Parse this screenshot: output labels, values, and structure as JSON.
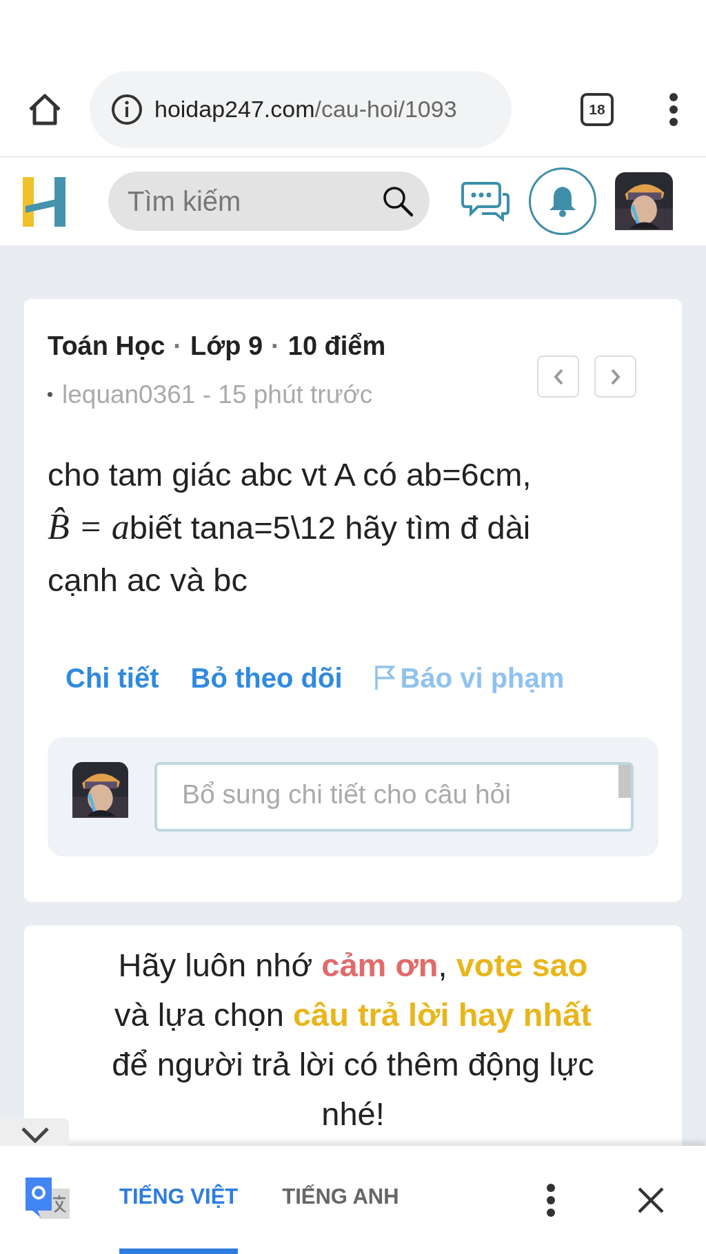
{
  "browser": {
    "url_domain": "hoidap247.com",
    "url_path": "/cau-hoi/1093",
    "tab_count": "18"
  },
  "header": {
    "search": {
      "placeholder": "Tìm kiếm"
    }
  },
  "question": {
    "subject": "Toán Học",
    "separator_1": "·",
    "grade": "Lớp 9",
    "separator_2": "·",
    "points": "10 điểm",
    "author_line": "lequan0361 - 15 phút trước",
    "body": [
      {
        "text": "cho tam giác abc vt A có ab=6cm, ",
        "kind": "text"
      },
      {
        "text": "B̂ = a",
        "kind": "math"
      },
      {
        "text": "biết tana=5\\12 hãy tìm đ dài cạnh ac và bc",
        "kind": "text"
      }
    ],
    "actions": [
      {
        "label": "Chi tiết",
        "kind": "link"
      },
      {
        "label": "Bỏ theo dõi",
        "kind": "link"
      },
      {
        "label": "Báo vi phạm",
        "kind": "report"
      }
    ],
    "comment": {
      "placeholder": "Bổ sung chi tiết cho câu hỏi"
    }
  },
  "reminder": [
    {
      "text": "Hãy luôn nhớ ",
      "kind": "plain"
    },
    {
      "text": "cảm ơn",
      "kind": "thanks"
    },
    {
      "text": ", ",
      "kind": "plain"
    },
    {
      "text": "vote sao",
      "kind": "highlight"
    },
    {
      "text": " và lựa chọn ",
      "kind": "plain"
    },
    {
      "text": "câu trả lời hay nhất",
      "kind": "highlight"
    },
    {
      "text": " để người trả lời có thêm động lực nhé!",
      "kind": "plain"
    }
  ],
  "translate_bar": {
    "tabs": [
      {
        "label": "TIẾNG VIỆT",
        "selected": true
      },
      {
        "label": "TIẾNG ANH",
        "selected": false
      }
    ]
  }
}
